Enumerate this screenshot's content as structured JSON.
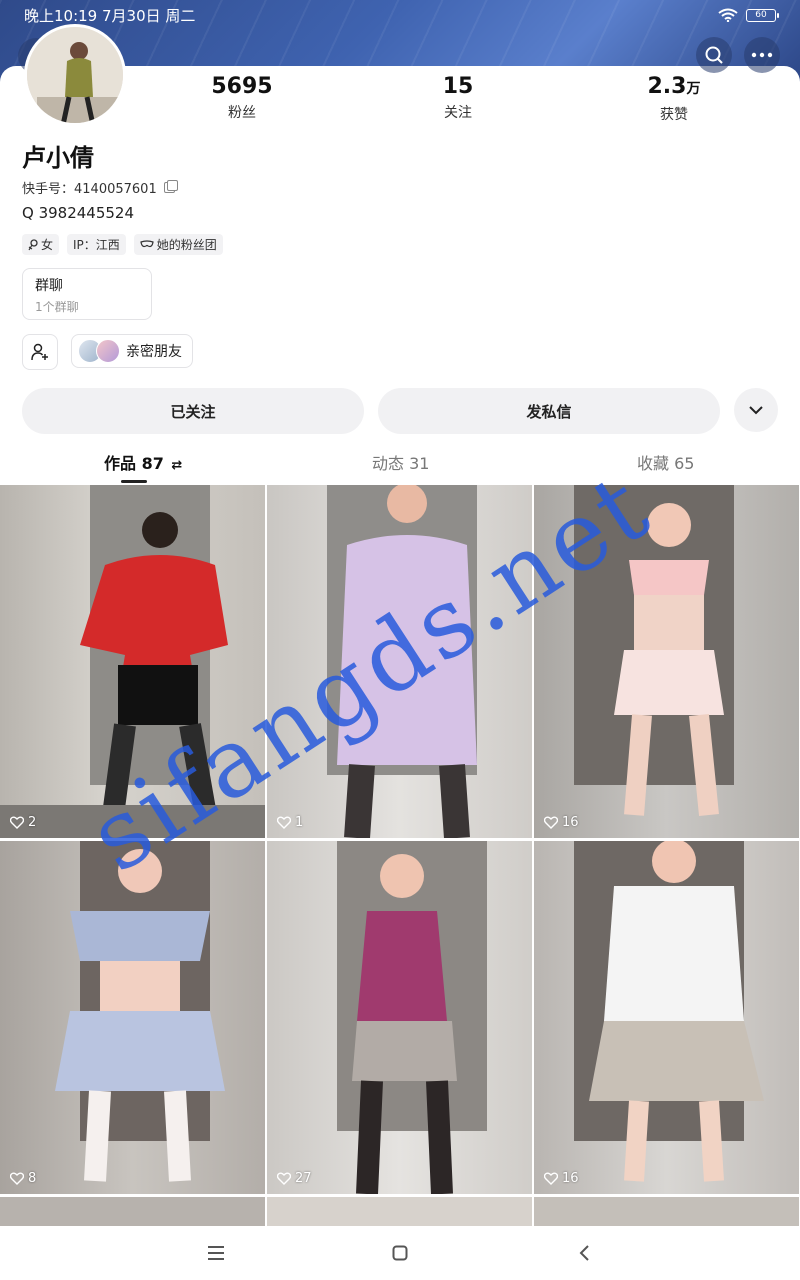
{
  "status_bar": {
    "time": "晚上10:19 7月30日 周二",
    "battery": "60"
  },
  "header": {
    "back_icon": "chevron-left-icon",
    "search_icon": "search-icon",
    "more_icon": "more-horizontal-icon"
  },
  "profile": {
    "stats": [
      {
        "value": "5695",
        "unit": "",
        "label": "粉丝"
      },
      {
        "value": "15",
        "unit": "",
        "label": "关注"
      },
      {
        "value": "2.3",
        "unit": "万",
        "label": "获赞"
      }
    ],
    "name": "卢小倩",
    "kuaishou_id_label": "快手号：4140057601",
    "qq": "Q 3982445524",
    "tags": {
      "gender": "女",
      "ip": "IP：江西",
      "fans_club": "她的粉丝团"
    },
    "group_chat": {
      "title": "群聊",
      "subtitle": "1个群聊"
    },
    "close_friends": "亲密朋友"
  },
  "actions": {
    "followed": "已关注",
    "message": "发私信"
  },
  "tabs": [
    {
      "label": "作品 87",
      "extra": "⇄"
    },
    {
      "label": "动态 31"
    },
    {
      "label": "收藏 65"
    }
  ],
  "videos": [
    {
      "likes": "2"
    },
    {
      "likes": "1"
    },
    {
      "likes": "16"
    },
    {
      "likes": "8"
    },
    {
      "likes": "27"
    },
    {
      "likes": "16"
    }
  ],
  "watermark": "sifangds.net",
  "colors": {
    "banner": "#3f63b0",
    "watermark": "#2855dc"
  }
}
